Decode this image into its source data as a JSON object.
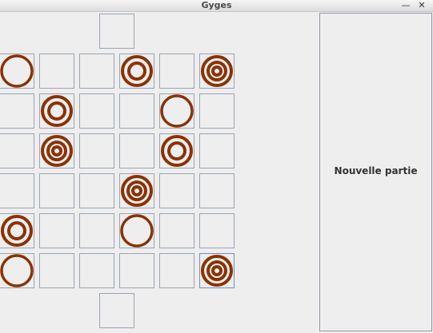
{
  "window": {
    "title": "Gyges",
    "minimize_glyph": "—",
    "close_glyph": "✕"
  },
  "side_panel": {
    "new_game_label": "Nouvelle partie"
  },
  "colors": {
    "piece": "#8b3203"
  },
  "board": {
    "columns": 6,
    "rows": 6,
    "pieces": [
      [
        1,
        0,
        0,
        2,
        0,
        3
      ],
      [
        0,
        2,
        0,
        0,
        1,
        0
      ],
      [
        0,
        3,
        0,
        0,
        2,
        0
      ],
      [
        0,
        0,
        0,
        3,
        0,
        0
      ],
      [
        2,
        0,
        0,
        1,
        0,
        0
      ],
      [
        1,
        0,
        0,
        0,
        0,
        3
      ]
    ],
    "selected_cell": [
      5,
      5
    ],
    "goal_cells": [
      "top",
      "bottom"
    ]
  }
}
